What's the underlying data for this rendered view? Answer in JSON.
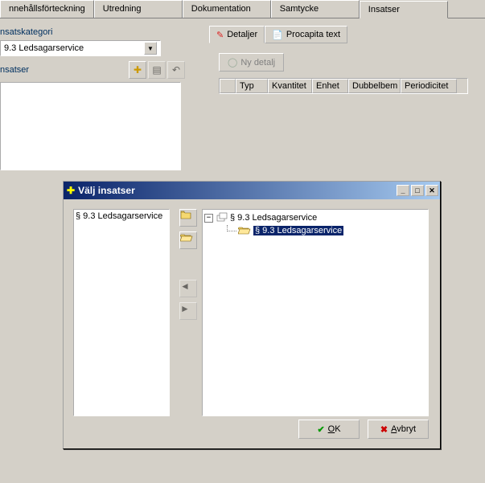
{
  "main_tabs": {
    "t0": "nnehållsförteckning",
    "t1": "Utredning",
    "t2": "Dokumentation",
    "t3": "Samtycke",
    "t4": "Insatser"
  },
  "left": {
    "kategori_label": "nsatskategori",
    "kategori_value": "9.3 Ledsagarservice",
    "insatser_label": "nsatser"
  },
  "right": {
    "subtab1": "Detaljer",
    "subtab2": "Procapita text",
    "new_btn": "Ny detalj",
    "cols": {
      "c0": "",
      "c1": "Typ",
      "c2": "Kvantitet",
      "c3": "Enhet",
      "c4": "Dubbelbem",
      "c5": "Periodicitet"
    }
  },
  "dialog": {
    "title": "Välj insatser",
    "left_item": "§ 9.3 Ledsagarservice",
    "tree_root": "§ 9.3 Ledsagarservice",
    "tree_child": "§ 9.3 Ledsagarservice",
    "ok": "OK",
    "cancel": "Avbryt"
  }
}
